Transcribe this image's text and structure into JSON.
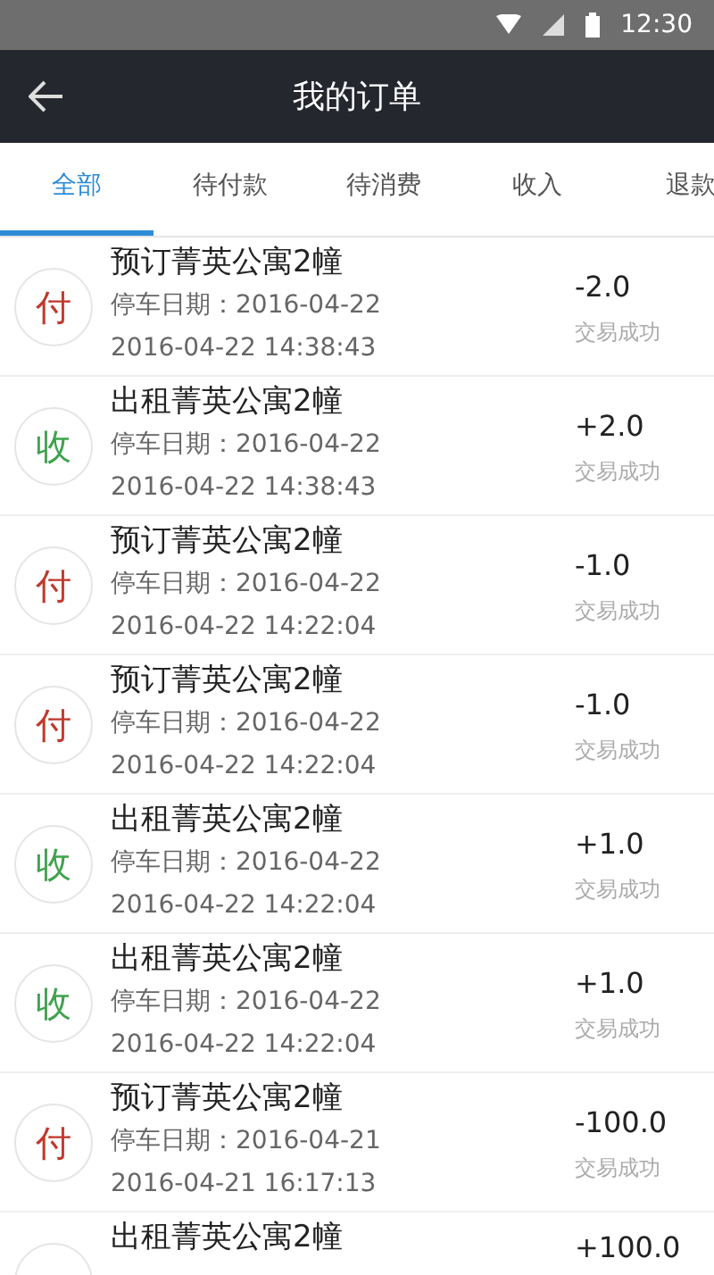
{
  "status_bar": {
    "time": "12:30"
  },
  "header": {
    "title": "我的订单"
  },
  "tabs": [
    {
      "label": "全部",
      "selected": true
    },
    {
      "label": "待付款",
      "selected": false
    },
    {
      "label": "待消费",
      "selected": false
    },
    {
      "label": "收入",
      "selected": false
    },
    {
      "label": "退款",
      "selected": false
    }
  ],
  "orders": [
    {
      "kind": "pay",
      "badge": "付",
      "title": "预订菁英公寓2幢",
      "parking_date": "停车日期：2016-04-22",
      "time": "2016-04-22 14:38:43",
      "amount": "-2.0",
      "status": "交易成功"
    },
    {
      "kind": "receive",
      "badge": "收",
      "title": "出租菁英公寓2幢",
      "parking_date": "停车日期：2016-04-22",
      "time": "2016-04-22 14:38:43",
      "amount": "+2.0",
      "status": "交易成功"
    },
    {
      "kind": "pay",
      "badge": "付",
      "title": "预订菁英公寓2幢",
      "parking_date": "停车日期：2016-04-22",
      "time": "2016-04-22 14:22:04",
      "amount": "-1.0",
      "status": "交易成功"
    },
    {
      "kind": "pay",
      "badge": "付",
      "title": "预订菁英公寓2幢",
      "parking_date": "停车日期：2016-04-22",
      "time": "2016-04-22 14:22:04",
      "amount": "-1.0",
      "status": "交易成功"
    },
    {
      "kind": "receive",
      "badge": "收",
      "title": "出租菁英公寓2幢",
      "parking_date": "停车日期：2016-04-22",
      "time": "2016-04-22 14:22:04",
      "amount": "+1.0",
      "status": "交易成功"
    },
    {
      "kind": "receive",
      "badge": "收",
      "title": "出租菁英公寓2幢",
      "parking_date": "停车日期：2016-04-22",
      "time": "2016-04-22 14:22:04",
      "amount": "+1.0",
      "status": "交易成功"
    },
    {
      "kind": "pay",
      "badge": "付",
      "title": "预订菁英公寓2幢",
      "parking_date": "停车日期：2016-04-21",
      "time": "2016-04-21 16:17:13",
      "amount": "-100.0",
      "status": "交易成功"
    },
    {
      "kind": "receive",
      "title": "出租菁英公寓2幢",
      "amount": "+100.0"
    }
  ]
}
